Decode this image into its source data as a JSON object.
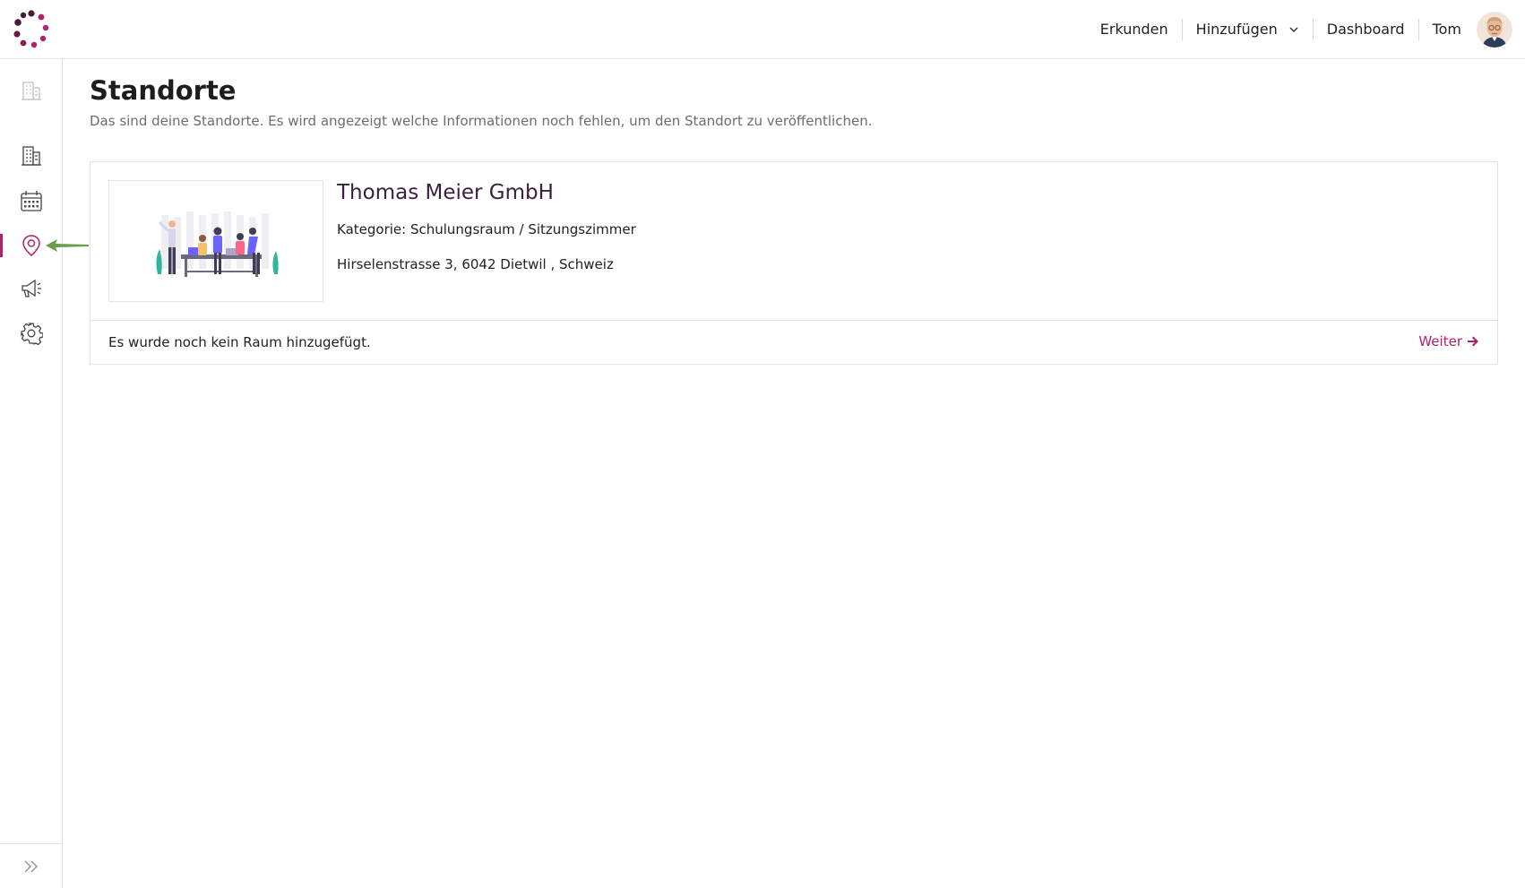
{
  "header": {
    "nav": [
      {
        "label": "Erkunden"
      },
      {
        "label": "Hinzufügen"
      },
      {
        "label": "Dashboard"
      }
    ],
    "user_name": "Tom"
  },
  "sidebar": {
    "items": [
      {
        "icon": "building-faded-icon"
      },
      {
        "icon": "building-icon"
      },
      {
        "icon": "calendar-icon"
      },
      {
        "icon": "location-pin-icon",
        "active": true
      },
      {
        "icon": "megaphone-icon"
      },
      {
        "icon": "gear-icon"
      }
    ],
    "expand_icon": "double-chevron-right-icon"
  },
  "page": {
    "title": "Standorte",
    "subtitle": "Das sind deine Standorte. Es wird angezeigt welche Informationen noch fehlen, um den Standort zu veröffentlichen."
  },
  "location": {
    "name": "Thomas Meier GmbH",
    "category": "Kategorie: Schulungsraum / Sitzungszimmer",
    "address": "Hirselenstrasse 3, 6042 Dietwil , Schweiz",
    "footer_message": "Es wurde noch kein Raum hinzugefügt.",
    "action_label": "Weiter"
  },
  "colors": {
    "accent": "#b0206e",
    "title": "#3b1f3f",
    "arrow": "#6a9e4c"
  }
}
